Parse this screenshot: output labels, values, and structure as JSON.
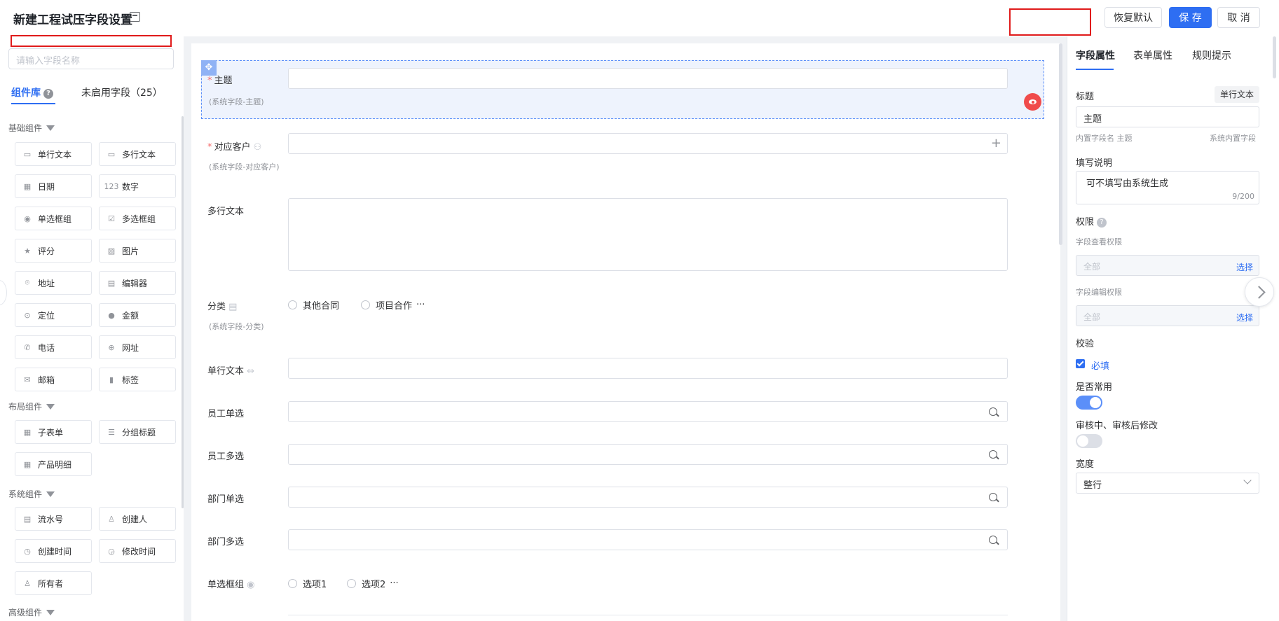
{
  "header": {
    "title": "新建工程试压字段设置",
    "restore_label": "恢复默认",
    "save_label": "保 存",
    "cancel_label": "取 消"
  },
  "left": {
    "search_placeholder": "请输入字段名称",
    "tabs": [
      {
        "label": "组件库",
        "active": true
      },
      {
        "label": "未启用字段（25）",
        "active": false
      }
    ],
    "sections": [
      {
        "title": "基础组件",
        "items": [
          {
            "label": "单行文本",
            "icon": "input-icon"
          },
          {
            "label": "多行文本",
            "icon": "textarea-icon"
          },
          {
            "label": "日期",
            "icon": "calendar-icon"
          },
          {
            "label": "数字",
            "icon": "number-icon"
          },
          {
            "label": "单选框组",
            "icon": "radio-icon"
          },
          {
            "label": "多选框组",
            "icon": "checkbox-icon"
          },
          {
            "label": "评分",
            "icon": "star-icon"
          },
          {
            "label": "图片",
            "icon": "image-icon"
          },
          {
            "label": "地址",
            "icon": "location-pin-icon"
          },
          {
            "label": "编辑器",
            "icon": "editor-icon"
          },
          {
            "label": "定位",
            "icon": "locate-icon"
          },
          {
            "label": "金额",
            "icon": "money-icon"
          },
          {
            "label": "电话",
            "icon": "phone-icon"
          },
          {
            "label": "网址",
            "icon": "globe-icon"
          },
          {
            "label": "邮箱",
            "icon": "mail-icon"
          },
          {
            "label": "标签",
            "icon": "bookmark-icon"
          }
        ]
      },
      {
        "title": "布局组件",
        "items": [
          {
            "label": "子表单",
            "icon": "table-icon"
          },
          {
            "label": "分组标题",
            "icon": "group-title-icon"
          },
          {
            "label": "产品明细",
            "icon": "table-icon"
          }
        ]
      },
      {
        "title": "系统组件",
        "items": [
          {
            "label": "流水号",
            "icon": "serial-icon"
          },
          {
            "label": "创建人",
            "icon": "user-icon"
          },
          {
            "label": "创建时间",
            "icon": "clock-icon"
          },
          {
            "label": "修改时间",
            "icon": "edit-clock-icon"
          },
          {
            "label": "所有者",
            "icon": "user-icon"
          }
        ]
      },
      {
        "title": "高级组件",
        "items": []
      }
    ]
  },
  "form": {
    "fields": [
      {
        "label": "主题",
        "required": true,
        "hint": "(系统字段-主题)"
      },
      {
        "label": "对应客户",
        "required": true,
        "hint": "(系统字段-对应客户)"
      },
      {
        "label": "多行文本",
        "required": false,
        "hint": ""
      },
      {
        "label": "分类",
        "required": false,
        "hint": "(系统字段-分类)",
        "options": [
          "其他合同",
          "项目合作"
        ],
        "more": "···"
      },
      {
        "label": "单行文本",
        "required": false,
        "hint": ""
      },
      {
        "label": "员工单选",
        "required": false,
        "hint": ""
      },
      {
        "label": "员工多选",
        "required": false,
        "hint": ""
      },
      {
        "label": "部门单选",
        "required": false,
        "hint": ""
      },
      {
        "label": "部门多选",
        "required": false,
        "hint": ""
      },
      {
        "label": "单选框组",
        "required": false,
        "hint": "",
        "options": [
          "选项1",
          "选项2"
        ],
        "more": "···"
      }
    ]
  },
  "right": {
    "tabs": [
      {
        "label": "字段属性",
        "active": true
      },
      {
        "label": "表单属性",
        "active": false
      },
      {
        "label": "规则提示",
        "active": false
      }
    ],
    "title_label": "标题",
    "type_tag": "单行文本",
    "title_value": "主题",
    "builtin_name": "内置字段名 主题",
    "builtin_system": "系统内置字段",
    "desc_label": "填写说明",
    "desc_value": "可不填写由系统生成",
    "desc_count": "9/200",
    "perm_label": "权限",
    "view_perm_label": "字段查看权限",
    "view_perm_value": "全部",
    "edit_perm_label": "字段编辑权限",
    "edit_perm_value": "全部",
    "select_link": "选择",
    "validate_label": "校验",
    "required_check": "必填",
    "required_checked": true,
    "common_label": "是否常用",
    "common_on": true,
    "audit_label": "审核中、审核后修改",
    "audit_on": false,
    "width_label": "宽度",
    "width_value": "整行",
    "colors": {
      "accent": "#2e6ef2",
      "toggle_off": "#dcdfe6"
    }
  }
}
